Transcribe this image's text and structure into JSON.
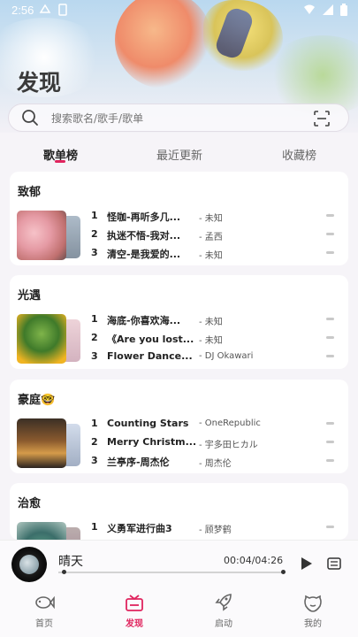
{
  "status_bar": {
    "time": "2:56"
  },
  "page": {
    "title": "发现"
  },
  "search": {
    "placeholder": "搜索歌名/歌手/歌单"
  },
  "tabs": [
    {
      "label": "歌单榜",
      "active": true
    },
    {
      "label": "最近更新",
      "active": false
    },
    {
      "label": "收藏榜",
      "active": false
    }
  ],
  "playlists": [
    {
      "title": "致郁",
      "tracks": [
        {
          "rank": "1",
          "song": "怪咖-再听多几...",
          "artist": "- 未知"
        },
        {
          "rank": "2",
          "song": "执迷不悟-我对...",
          "artist": "- 孟西"
        },
        {
          "rank": "3",
          "song": "清空-是我爱的...",
          "artist": "- 未知"
        }
      ]
    },
    {
      "title": "光遇",
      "tracks": [
        {
          "rank": "1",
          "song": "海底-你喜欢海...",
          "artist": "- 未知"
        },
        {
          "rank": "2",
          "song": "《Are you lost...",
          "artist": "- 未知"
        },
        {
          "rank": "3",
          "song": "Flower Dance...",
          "artist": "- DJ Okawari"
        }
      ]
    },
    {
      "title": "豪庭🤓",
      "tracks": [
        {
          "rank": "1",
          "song": "Counting Stars",
          "artist": "- OneRepublic"
        },
        {
          "rank": "2",
          "song": "Merry Christm...",
          "artist": "- 宇多田ヒカル"
        },
        {
          "rank": "3",
          "song": "兰亭序-周杰伦",
          "artist": "- 周杰伦"
        }
      ]
    },
    {
      "title": "治愈",
      "tracks": [
        {
          "rank": "1",
          "song": "义勇军进行曲3",
          "artist": "- 顾梦鹤"
        }
      ]
    }
  ],
  "player": {
    "title": "晴天",
    "time": "00:04/04:26",
    "progress": 0.016
  },
  "nav": [
    {
      "label": "首页",
      "icon": "fish-icon",
      "active": false
    },
    {
      "label": "发现",
      "icon": "gift-box-icon",
      "active": true
    },
    {
      "label": "启动",
      "icon": "rocket-icon",
      "active": false
    },
    {
      "label": "我的",
      "icon": "face-icon",
      "active": false
    }
  ],
  "colors": {
    "accent": "#e0245e",
    "background": "#f6f4f8"
  }
}
